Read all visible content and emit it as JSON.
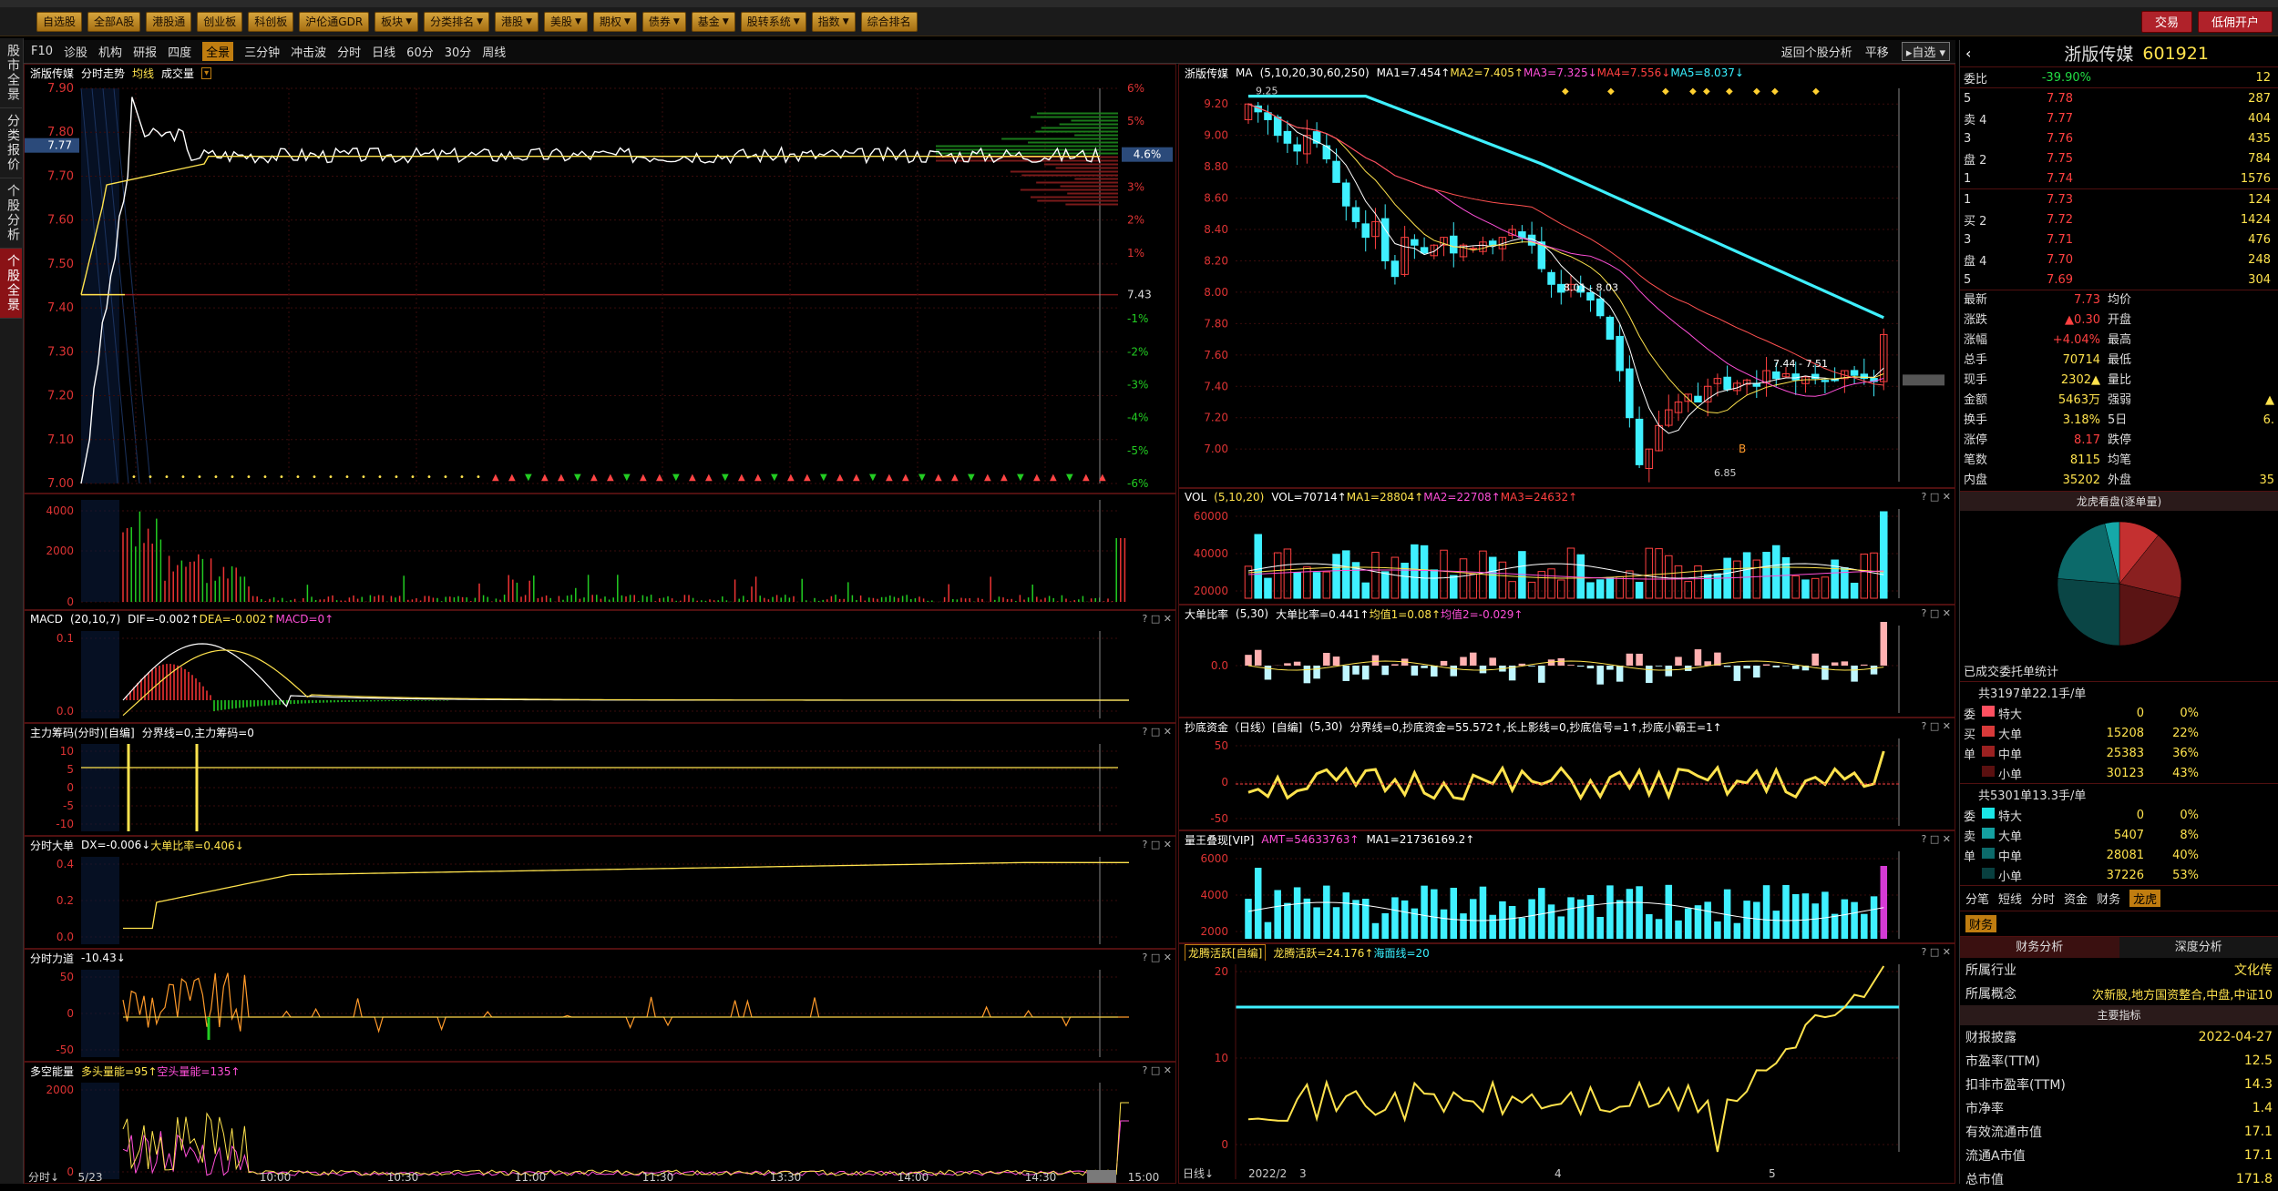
{
  "toolbar": {
    "items": [
      "自选股",
      "全部A股",
      "港股通",
      "创业板",
      "科创板",
      "沪伦通GDR",
      "板块",
      "分类排名",
      "港股",
      "美股",
      "期权",
      "债券",
      "基金",
      "股转系统",
      "指数",
      "综合排名"
    ],
    "trade_label": "交易",
    "margin_label": "低佣开户"
  },
  "sidebar": {
    "tabs": [
      "股市全景",
      "分类报价",
      "个股分析",
      "个股全景"
    ]
  },
  "subbar": {
    "items": [
      "F10",
      "诊股",
      "机构",
      "研报",
      "四度",
      "全景",
      "三分钟",
      "冲击波",
      "分时",
      "日线",
      "60分",
      "30分",
      "周线"
    ],
    "active": "全景",
    "return_label": "返回个股分析",
    "flat_label": "平移",
    "watch_label": "自选"
  },
  "intraday": {
    "title": "浙版传媒",
    "mode": "分时走势",
    "avg_label": "均线",
    "vol_label": "成交量",
    "prev_close": "7.43",
    "current": "7.77",
    "current_pct": "4.6%",
    "price_ticks": [
      "7.90",
      "7.80",
      "7.70",
      "7.60",
      "7.50",
      "7.40",
      "7.30",
      "7.20",
      "7.10",
      "7.00"
    ],
    "pct_ticks": [
      "6%",
      "5%",
      "4%",
      "3%",
      "2%",
      "1%",
      "",
      "-1%",
      "-2%",
      "-3%",
      "-4%",
      "-5%",
      "-6%"
    ],
    "time_ticks": [
      "5/23",
      "10:00",
      "10:30",
      "11:00",
      "11:30",
      "13:30",
      "14:00",
      "14:30",
      "14:53",
      "15:00"
    ],
    "vol_ticks": [
      "4000",
      "2000",
      "0"
    ],
    "footer_label": "分时"
  },
  "macd_intra": {
    "name": "MACD",
    "params": "(20,10,7)",
    "dif": "DIF=-0.002↑",
    "dea": "DEA=-0.002↑",
    "macd": "MACD=0↑",
    "ticks": [
      "0.1",
      "0.0"
    ]
  },
  "main_chips": {
    "name": "主力筹码(分时)[自编]",
    "line": "分界线=0,主力筹码=0",
    "ticks": [
      "10",
      "5",
      "0",
      "-5",
      "-10"
    ]
  },
  "big_orders": {
    "name": "分时大单",
    "dx": "DX=-0.006↓",
    "ratio": "大单比率=0.406↓",
    "ticks": [
      "0.4",
      "0.2",
      "0.0"
    ]
  },
  "intra_force": {
    "name": "分时力道",
    "val": "-10.43↓",
    "ticks": [
      "50",
      "0",
      "-50"
    ]
  },
  "bull_bear": {
    "name": "多空能量",
    "bull": "多头量能=95↑",
    "bear": "空头量能=135↑",
    "ticks": [
      "2000",
      "0"
    ]
  },
  "kline": {
    "title": "浙版传媒",
    "ma_label": "MA",
    "ma_params": "(5,10,20,30,60,250)",
    "ma1": "MA1=7.454↑",
    "ma2": "MA2=7.405↑",
    "ma3": "MA3=7.325↓",
    "ma4": "MA4=7.556↓",
    "ma5": "MA5=8.037↓",
    "price_ticks": [
      "9.20",
      "9.00",
      "8.80",
      "8.60",
      "8.40",
      "8.20",
      "8.00",
      "7.80",
      "7.60",
      "7.40",
      "7.20",
      "7.00"
    ],
    "annot_high": "9.25",
    "annot_range1": "8.01 - 8.03",
    "annot_range2": "7.44 - 7.51",
    "annot_low": "6.85",
    "annot_b": "B",
    "x_ticks": [
      "2022/2",
      "3",
      "4",
      "5"
    ],
    "footer_label": "日线"
  },
  "vol_daily": {
    "name": "VOL",
    "params": "(5,10,20)",
    "vol": "VOL=70714↑",
    "ma1": "MA1=28804↑",
    "ma2": "MA2=22708↑",
    "ma3": "MA3=24632↑",
    "ticks": [
      "60000",
      "40000",
      "20000"
    ]
  },
  "big_ratio": {
    "name": "大单比率",
    "params": "(5,30)",
    "ratio": "大单比率=0.441↑",
    "avg1": "均值1=0.08↑",
    "avg2": "均值2=-0.029↑",
    "ticks": [
      "0.0"
    ]
  },
  "bottom_fund": {
    "name": "抄底资金（日线）[自编]",
    "params": "(5,30)",
    "line": "分界线=0,抄底资金=55.572↑,长上影线=0,抄底信号=1↑,抄底小霸王=1↑",
    "ticks": [
      "50",
      "0",
      "-50"
    ]
  },
  "vol_king": {
    "name": "量王叠现[VIP]",
    "amt": "AMT=54633763↑",
    "ma1": "MA1=21736169.2↑",
    "ticks": [
      "6000",
      "4000",
      "2000"
    ]
  },
  "dragon": {
    "name": "龙腾活跃[自编]",
    "active": "龙腾活跃=24.176↑",
    "sea": "海面线=20",
    "ticks": [
      "20",
      "10",
      "0"
    ]
  },
  "quote": {
    "name": "浙版传媒",
    "code": "601921",
    "webi_label": "委比",
    "webi": "-39.90%",
    "webi_extra": "12",
    "sell": [
      {
        "lvl": "5",
        "price": "7.78",
        "vol": "287"
      },
      {
        "lvl": "4",
        "price": "7.77",
        "vol": "404"
      },
      {
        "lvl": "3",
        "price": "7.76",
        "vol": "435"
      },
      {
        "lvl": "2",
        "price": "7.75",
        "vol": "784"
      },
      {
        "lvl": "1",
        "price": "7.74",
        "vol": "1576"
      }
    ],
    "buy": [
      {
        "lvl": "1",
        "price": "7.73",
        "vol": "124"
      },
      {
        "lvl": "2",
        "price": "7.72",
        "vol": "1424"
      },
      {
        "lvl": "3",
        "price": "7.71",
        "vol": "476"
      },
      {
        "lvl": "4",
        "price": "7.70",
        "vol": "248"
      },
      {
        "lvl": "5",
        "price": "7.69",
        "vol": "304"
      }
    ],
    "sell_label": "卖",
    "buy_label": "买",
    "pan_label": "盘",
    "stats": [
      [
        "最新",
        "7.73",
        "均价",
        ""
      ],
      [
        "涨跌",
        "▲0.30",
        "开盘",
        ""
      ],
      [
        "涨幅",
        "+4.04%",
        "最高",
        ""
      ],
      [
        "总手",
        "70714",
        "最低",
        ""
      ],
      [
        "现手",
        "2302▲",
        "量比",
        ""
      ],
      [
        "金额",
        "5463万",
        "强弱",
        "▲"
      ],
      [
        "换手",
        "3.18%",
        "5日",
        "6."
      ],
      [
        "涨停",
        "8.17",
        "跌停",
        ""
      ],
      [
        "笔数",
        "8115",
        "均笔",
        ""
      ],
      [
        "内盘",
        "35202",
        "外盘",
        "35"
      ]
    ],
    "dragon_title": "龙虎看盘(逐单量)",
    "done_label": "已成交委托单统计",
    "buy_stats_head": "共3197单22.1手/单",
    "buy_rows": [
      {
        "side": "委",
        "lbl": "特大",
        "vol": "0",
        "pct": "0%",
        "color": "#ff5060"
      },
      {
        "side": "买",
        "lbl": "大单",
        "vol": "15208",
        "pct": "22%",
        "color": "#d83a3a"
      },
      {
        "side": "单",
        "lbl": "中单",
        "vol": "25383",
        "pct": "36%",
        "color": "#9a2020"
      },
      {
        "side": "",
        "lbl": "小单",
        "vol": "30123",
        "pct": "43%",
        "color": "#5a1010"
      }
    ],
    "sell_stats_head": "共5301单13.3手/单",
    "sell_rows": [
      {
        "side": "委",
        "lbl": "特大",
        "vol": "0",
        "pct": "0%",
        "color": "#1ae6e6"
      },
      {
        "side": "卖",
        "lbl": "大单",
        "vol": "5407",
        "pct": "8%",
        "color": "#14a0a0"
      },
      {
        "side": "单",
        "lbl": "中单",
        "vol": "28081",
        "pct": "40%",
        "color": "#0c6a6a"
      },
      {
        "side": "",
        "lbl": "小单",
        "vol": "37226",
        "pct": "53%",
        "color": "#083f3f"
      }
    ],
    "tabs": [
      "分笔",
      "短线",
      "分时",
      "资金",
      "财务",
      "龙虎"
    ],
    "active_tab": "龙虎",
    "fin_tab": "财务",
    "fin_analysis": "财务分析",
    "deep_analysis": "深度分析",
    "industry_label": "所属行业",
    "industry": "文化传",
    "concept_label": "所属概念",
    "concept": "次新股,地方国资整合,中盘,中证10",
    "main_metrics": "主要指标",
    "fin_rows": [
      [
        "财报披露",
        "2022-04-27"
      ],
      [
        "市盈率(TTM)",
        "12.5"
      ],
      [
        "扣非市盈率(TTM)",
        "14.3"
      ],
      [
        "市净率",
        "1.4"
      ],
      [
        "有效流通市值",
        "17.1"
      ],
      [
        "流通A市值",
        "17.1"
      ],
      [
        "总市值",
        "171.8"
      ]
    ]
  },
  "pie": [
    {
      "label": "特大买",
      "value": 0,
      "color": "#ff5060"
    },
    {
      "label": "大单买",
      "value": 15208,
      "color": "#c43030"
    },
    {
      "label": "中单买",
      "value": 25383,
      "color": "#8a2020"
    },
    {
      "label": "小单买",
      "value": 30123,
      "color": "#5a1414"
    },
    {
      "label": "小单卖",
      "value": 37226,
      "color": "#0a4545"
    },
    {
      "label": "中单卖",
      "value": 28081,
      "color": "#0c6a6a"
    },
    {
      "label": "大单卖",
      "value": 5407,
      "color": "#16a8a8"
    }
  ]
}
